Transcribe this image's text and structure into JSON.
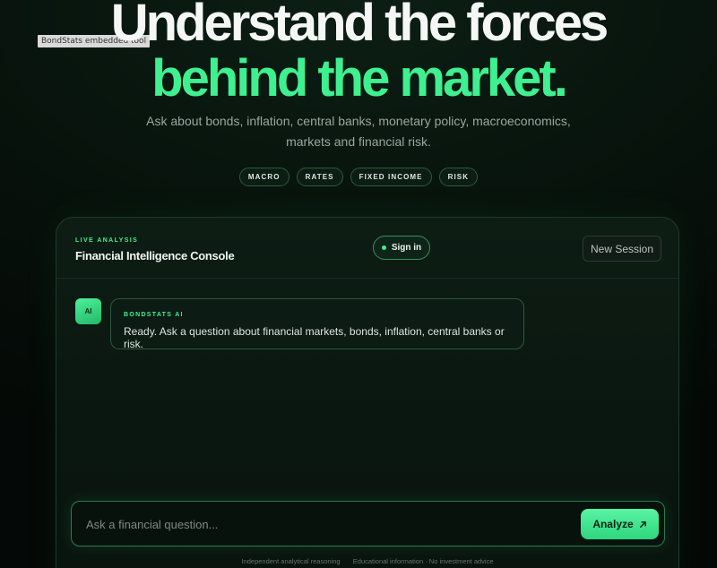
{
  "embed_tag": "BondStats embedded tool",
  "hero": {
    "title_line1": "Understand the forces",
    "title_line2": "behind the market.",
    "subtitle": "Ask about bonds, inflation, central banks, monetary policy, macroeconomics, markets and financial risk.",
    "chips": [
      "MACRO",
      "RATES",
      "FIXED INCOME",
      "RISK"
    ]
  },
  "console": {
    "eyebrow": "LIVE ANALYSIS",
    "title": "Financial Intelligence Console",
    "signin_label": "Sign in",
    "new_session_label": "New Session",
    "messages": [
      {
        "avatar": "AI",
        "sender": "BONDSTATS AI",
        "text": "Ready. Ask a question about financial markets, bonds, inflation, central banks or risk."
      }
    ],
    "input_placeholder": "Ask a financial question...",
    "analyze_label": "Analyze",
    "analyze_icon": "arrow-up-right-icon",
    "footer_left": "Independent analytical reasoning",
    "footer_right": "Educational information · No investment advice"
  },
  "colors": {
    "accent": "#3ef08f",
    "background": "#07110b",
    "panel_border": "#1d3b2a"
  }
}
